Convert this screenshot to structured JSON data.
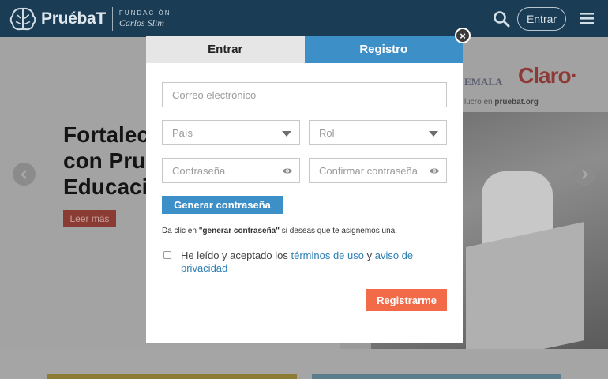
{
  "header": {
    "brand": "PruébaT",
    "foundation_line1": "FUNDACIÓN",
    "foundation_line2": "Carlos Slim",
    "login_label": "Entrar"
  },
  "hero": {
    "title_line1": "Fortalec",
    "title_line2": "con Prué",
    "title_line3": "Educació",
    "read_more": "Leer más",
    "sponsor_guate": "EMALA",
    "sponsor_claro": "Claro·",
    "sponsor_text_prefix": "lucro en",
    "sponsor_text_site": "pruebat.org"
  },
  "modal": {
    "tab_login": "Entrar",
    "tab_register": "Registro",
    "close": "×",
    "email_placeholder": "Correo electrónico",
    "country_value": "País",
    "role_value": "Rol",
    "password_placeholder": "Contraseña",
    "confirm_placeholder": "Confirmar contraseña",
    "generate_label": "Generar contraseña",
    "hint_prefix": "Da clic en ",
    "hint_bold": "\"generar contraseña\"",
    "hint_suffix": " si deseas que te asignemos una.",
    "terms_prefix": "He leído y aceptado los ",
    "terms_link": "términos de uso",
    "terms_and": " y ",
    "privacy_link_1": "aviso de",
    "privacy_link_2": "privacidad",
    "register_label": "Registrarme"
  },
  "colors": {
    "header_bg": "#1a3c55",
    "tab_active": "#3d8fc8",
    "register_button": "#f26a48",
    "link": "#2e7fb3"
  },
  "icons": [
    "brain-logo-icon",
    "search-icon",
    "menu-icon",
    "chevron-left-icon",
    "chevron-right-icon",
    "close-icon",
    "caret-down-icon",
    "eye-icon"
  ]
}
